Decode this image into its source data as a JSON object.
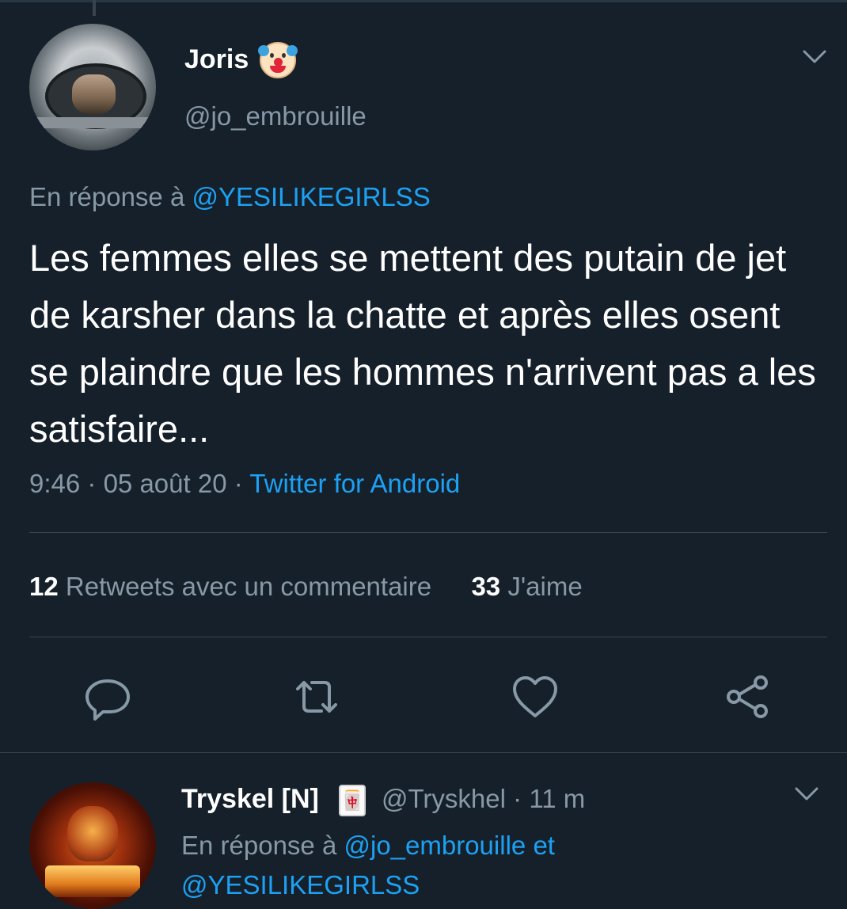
{
  "colors": {
    "background": "#15202b",
    "text_primary": "#ffffff",
    "text_secondary": "#8899a6",
    "link": "#1da1f2",
    "divider": "#38444d"
  },
  "main_tweet": {
    "author_name": "Joris",
    "author_emoji": "clown-face-emoji",
    "author_handle": "@jo_embrouille",
    "reply_prefix": "En réponse à",
    "reply_to": "@YESILIKEGIRLSS",
    "text": "Les femmes elles se mettent des putain de jet de karsher dans la chatte et après elles osent se plaindre que les hommes n'arrivent pas a les satisfaire...",
    "time": "9:46",
    "separator": "·",
    "date": "05 août 20",
    "source": "Twitter for Android",
    "stats": {
      "retweets_count": "12",
      "retweets_label": "Retweets avec un commentaire",
      "likes_count": "33",
      "likes_label": "J'aime"
    },
    "actions": [
      "reply-icon",
      "retweet-icon",
      "like-icon",
      "share-icon"
    ]
  },
  "reply_tweet": {
    "author_name": "Tryskel [N]",
    "author_emoji": "🀄",
    "author_handle": "@Tryskhel",
    "separator": "·",
    "time_ago": "11 m",
    "reply_prefix": "En réponse à",
    "reply_to_1": "@jo_embrouille",
    "reply_conj": "et",
    "reply_to_2": "@YESILIKEGIRLSS"
  }
}
